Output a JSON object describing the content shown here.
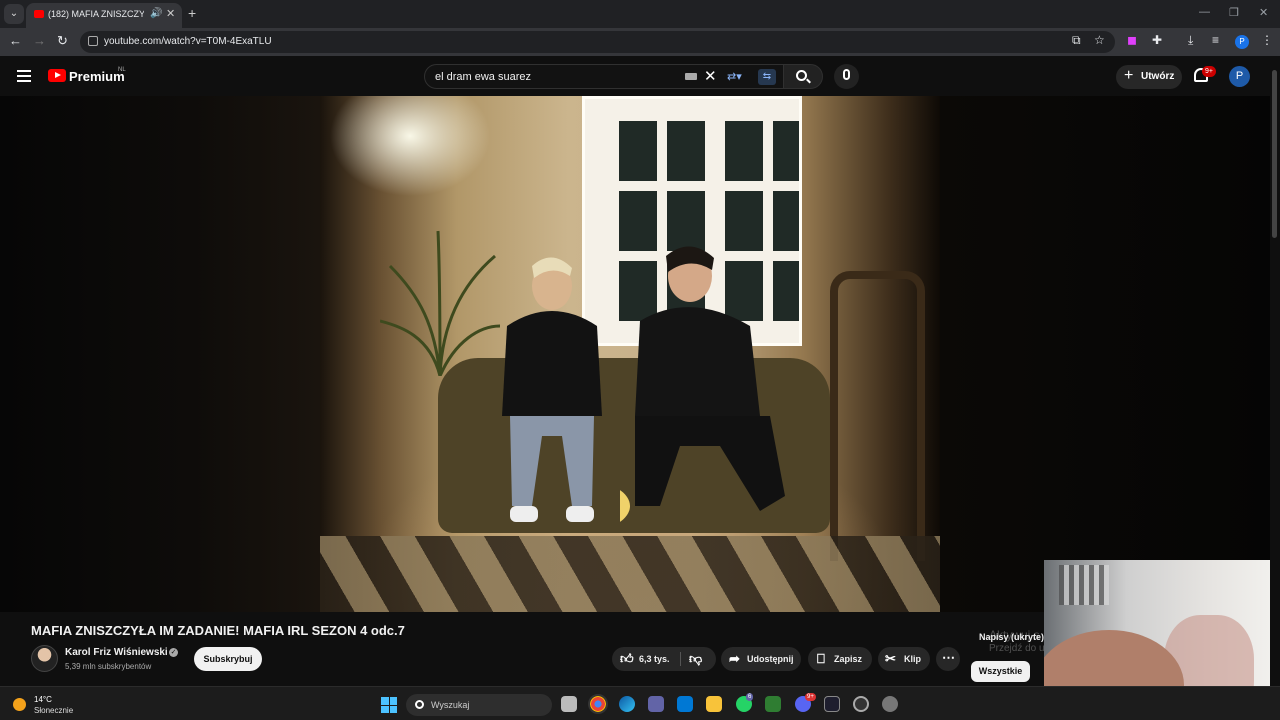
{
  "browser": {
    "tab_title": "(182) MAFIA ZNISZCZYŁA IM ZADANIE! MAFIA IRL SEZON 4 odc.7 - YouTube",
    "url": "youtube.com/watch?v=T0M-4ExaTLU",
    "profile_initial": "P"
  },
  "masthead": {
    "logo_text": "Premium",
    "logo_region": "NL",
    "search_query": "el dram ewa suarez",
    "create_label": "Utwórz",
    "notifications_badge": "9+",
    "avatar_initial": "P"
  },
  "video": {
    "title": "MAFIA ZNISZCZYŁA IM ZADANIE! MAFIA IRL SEZON 4 odc.7",
    "channel_name": "Karol Friz Wiśniewski",
    "subscribers": "5,39 mln subskrybentów",
    "subscribe_label": "Subskrybuj"
  },
  "actions": {
    "like_count": "6,3 tys.",
    "share_label": "Udostępnij",
    "save_label": "Zapisz",
    "clip_label": "Klip"
  },
  "captions_note": "Napisy (ukryte)",
  "watermark": {
    "line1": "Aktywuj s",
    "line2": "Przejdź do u"
  },
  "chips": {
    "all": "Wszystkie"
  },
  "taskbar": {
    "temperature": "14°C",
    "weather": "Słonecznie",
    "search_label": "Wyszukaj",
    "badge_whatsapp": "6",
    "badge_discord": "9+"
  },
  "colors": {
    "youtube_red": "#ff0000",
    "subscribe_bg": "#f1f1f1",
    "accent_blue": "#1a73e8"
  }
}
